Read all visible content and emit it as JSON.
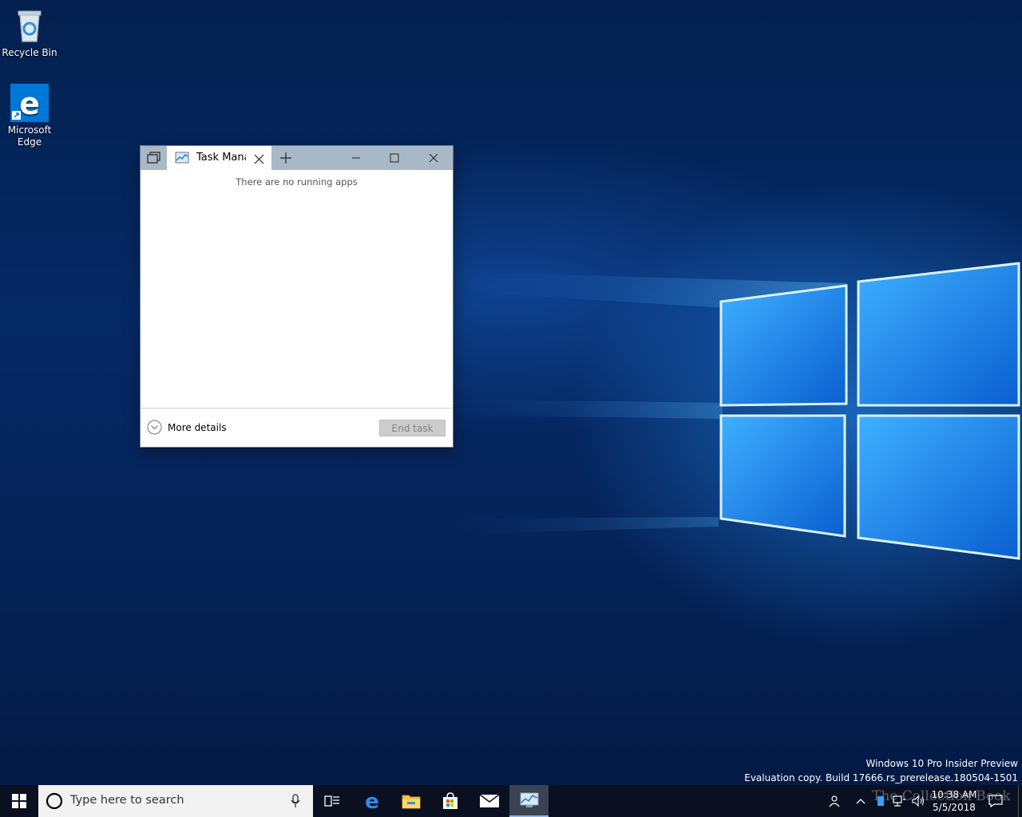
{
  "desktop": {
    "icons": [
      {
        "label": "Recycle Bin"
      },
      {
        "label": "Microsoft Edge"
      }
    ],
    "watermark": {
      "line1": "Windows 10 Pro Insider Preview",
      "line2": "Evaluation copy. Build 17666.rs_prerelease.180504-1501"
    }
  },
  "window": {
    "tab_title": "Task Manager",
    "empty_message": "There are no running apps",
    "more_details": "More details",
    "end_task": "End task"
  },
  "taskbar": {
    "search_placeholder": "Type here to search",
    "clock_time": "10:38 AM",
    "clock_date": "5/5/2018",
    "overlay_text": "The Collection Book"
  },
  "colors": {
    "titlebar": "#a9b8c6",
    "taskbar": "#0b1020",
    "accent": "#0078d7"
  }
}
